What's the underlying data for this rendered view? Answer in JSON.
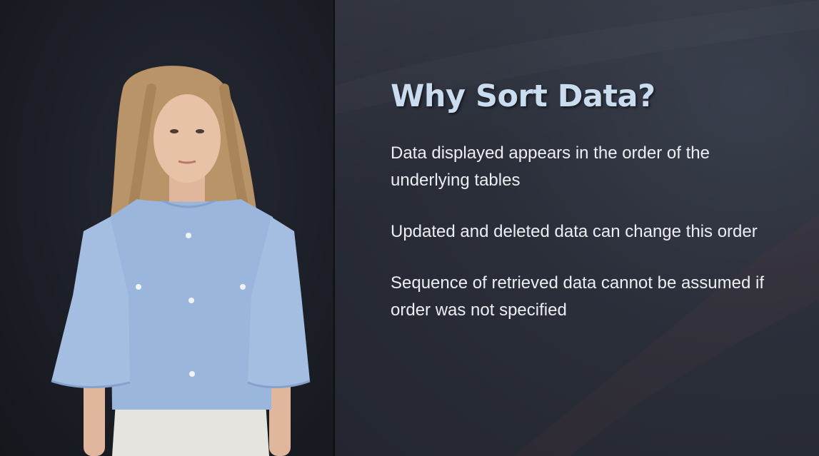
{
  "slide": {
    "title": "Why Sort Data?",
    "bullets": [
      "Data displayed appears in the order of the underlying tables",
      "Updated and deleted data can change this order",
      "Sequence of retrieved data cannot be assumed if order was not specified"
    ]
  },
  "colors": {
    "title": "#c9dcf0",
    "body_text": "#eceef2",
    "slide_background": "#2b2f3a",
    "presenter_background": "#1c1f27",
    "blouse": "#9ab6dd"
  }
}
